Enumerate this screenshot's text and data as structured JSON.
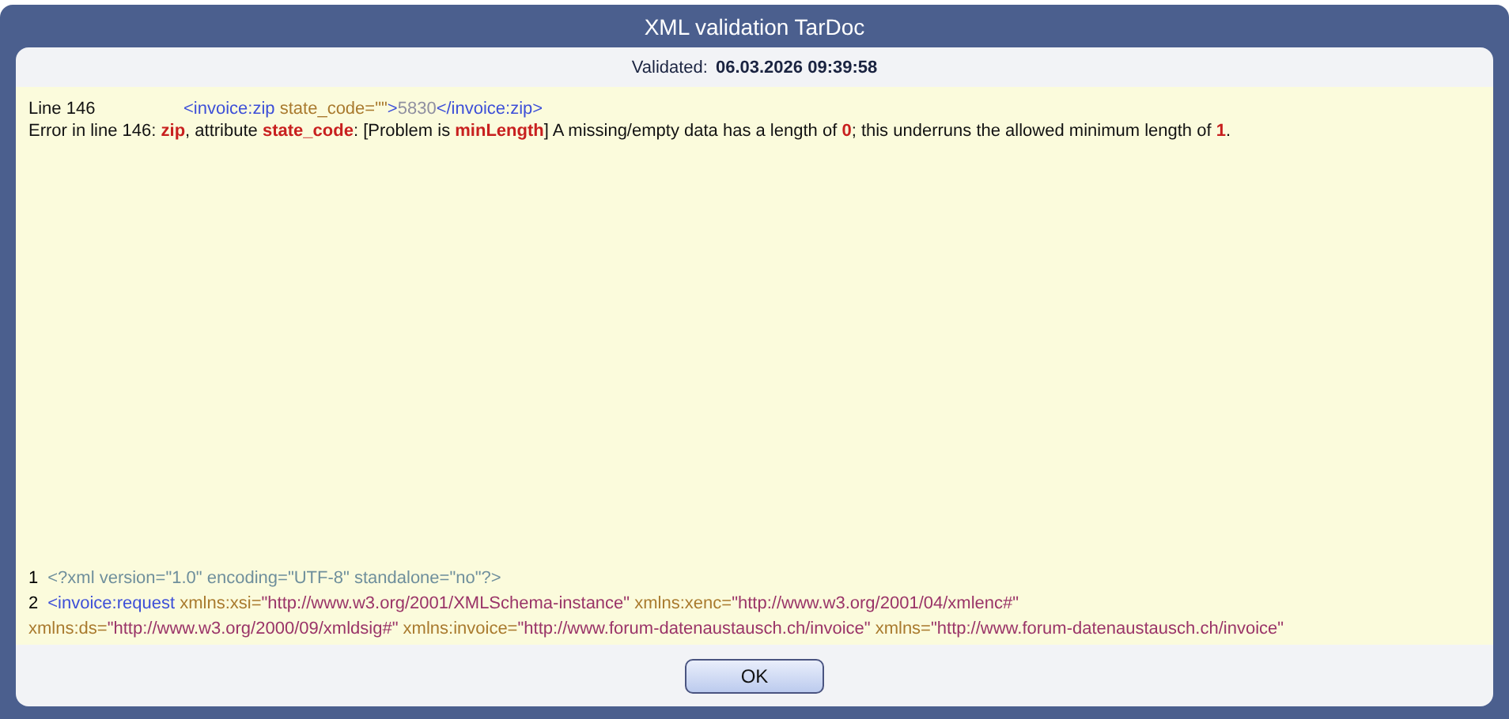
{
  "window": {
    "title": "XML validation TarDoc"
  },
  "validated": {
    "label": "Validated:",
    "value": "06.03.2026 09:39:58"
  },
  "error_location": {
    "label": "Line 146",
    "snippet": [
      {
        "kind": "tag",
        "text": "<invoice:zip"
      },
      {
        "kind": "attr",
        "text": " state_code=\"\""
      },
      {
        "kind": "tag",
        "text": ">"
      },
      {
        "kind": "content",
        "text": "5830"
      },
      {
        "kind": "tag",
        "text": "</invoice:zip>"
      }
    ]
  },
  "error_message": [
    {
      "kind": "plain",
      "text": "Error in line 146: "
    },
    {
      "kind": "highlight",
      "text": "zip"
    },
    {
      "kind": "plain",
      "text": ", attribute "
    },
    {
      "kind": "highlight",
      "text": "state_code"
    },
    {
      "kind": "plain",
      "text": ": [Problem is "
    },
    {
      "kind": "highlight",
      "text": "minLength"
    },
    {
      "kind": "plain",
      "text": "] A missing/empty data has a length of "
    },
    {
      "kind": "highlight",
      "text": "0"
    },
    {
      "kind": "plain",
      "text": "; this underruns the allowed minimum length of "
    },
    {
      "kind": "highlight",
      "text": "1"
    },
    {
      "kind": "plain",
      "text": "."
    }
  ],
  "source_lines": [
    {
      "number": "1",
      "segments": [
        {
          "kind": "pi",
          "text": "<?xml version=\"1.0\" encoding=\"UTF-8\" standalone=\"no\"?>"
        }
      ]
    },
    {
      "number": "2",
      "segments": [
        {
          "kind": "tag",
          "text": "<invoice:request"
        },
        {
          "kind": "attr",
          "text": " xmlns:xsi="
        },
        {
          "kind": "value",
          "text": "\"http://www.w3.org/2001/XMLSchema-instance\""
        },
        {
          "kind": "attr",
          "text": " xmlns:xenc="
        },
        {
          "kind": "value",
          "text": "\"http://www.w3.org/2001/04/xmlenc#\""
        }
      ]
    },
    {
      "segments": [
        {
          "kind": "attr",
          "text": "xmlns:ds="
        },
        {
          "kind": "value",
          "text": "\"http://www.w3.org/2000/09/xmldsig#\""
        },
        {
          "kind": "attr",
          "text": " xmlns:invoice="
        },
        {
          "kind": "value",
          "text": "\"http://www.forum-datenaustausch.ch/invoice\""
        },
        {
          "kind": "attr",
          "text": " xmlns="
        },
        {
          "kind": "value",
          "text": "\"http://www.forum-datenaustausch.ch/invoice\""
        }
      ]
    }
  ],
  "buttons": [
    {
      "label": "OK"
    }
  ]
}
